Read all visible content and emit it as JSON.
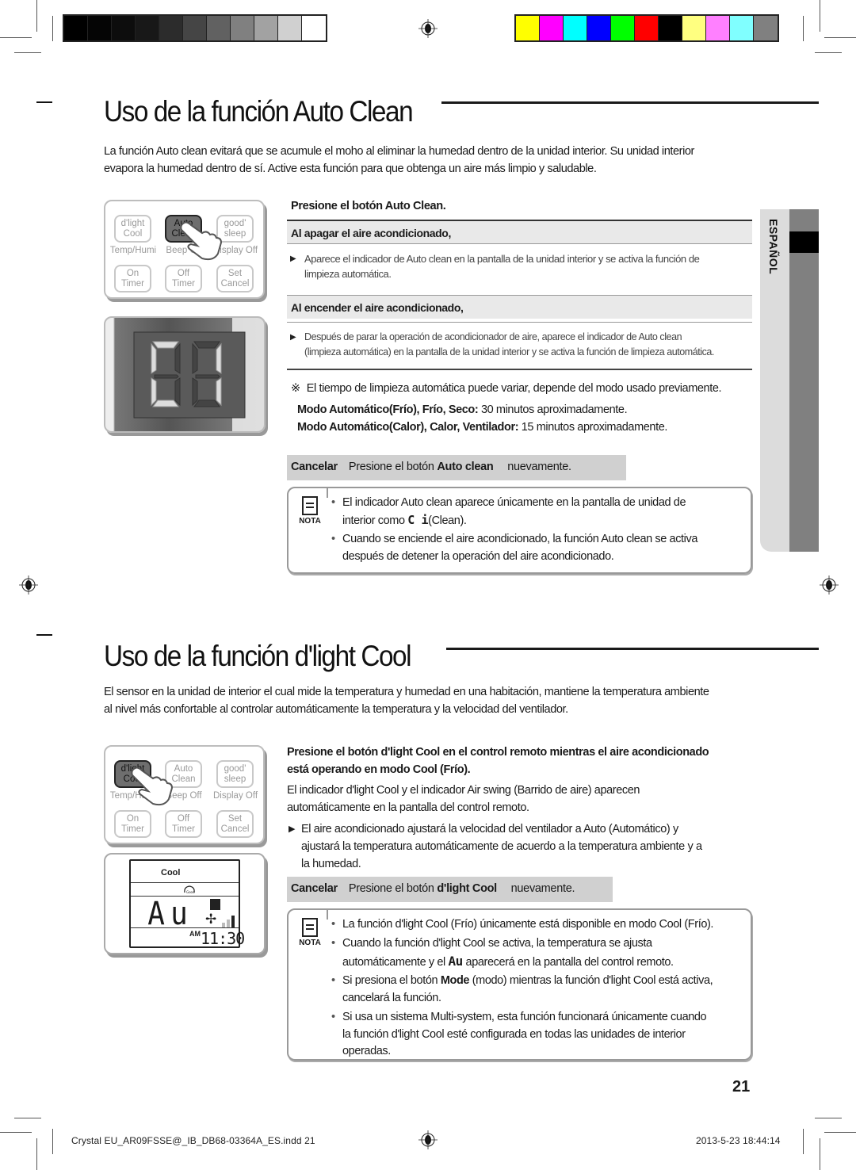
{
  "print_marks": {
    "grayscale_bar": [
      "#000000",
      "#050505",
      "#0d0d0d",
      "#181818",
      "#2c2c2c",
      "#454545",
      "#616161",
      "#808080",
      "#a2a2a2",
      "#d0d0d0",
      "#ffffff"
    ],
    "color_bar": [
      "#ffff00",
      "#ff00ff",
      "#00ffff",
      "#0000ff",
      "#00ff00",
      "#ff0000",
      "#000000",
      "#ffff80",
      "#ff80ff",
      "#80ffff",
      "#808080"
    ]
  },
  "section1": {
    "title": "Uso de la función Auto Clean",
    "intro_line1": "La función Auto clean evitará que se acumule el moho al eliminar la humedad dentro de la unidad interior. Su unidad interior",
    "intro_line2": "evapora la humedad dentro de sí. Active esta función para que obtenga un aire más limpio y saludable.",
    "remote": {
      "buttons": [
        {
          "line1": "d'light",
          "line2": "Cool",
          "sub": "Temp/Humi"
        },
        {
          "line1": "Auto",
          "line2": "Clean",
          "sub": "Beep Off"
        },
        {
          "line1": "good'",
          "line2": "sleep",
          "sub": "Display Off"
        },
        {
          "line1": "On",
          "line2": "Timer"
        },
        {
          "line1": "Off",
          "line2": "Timer"
        },
        {
          "line1": "Set",
          "line2": "Cancel"
        }
      ]
    },
    "step": {
      "prefix": "Presione el botón ",
      "button": "Auto Clean",
      "suffix": "."
    },
    "off_heading": "Al apagar el aire acondicionado,",
    "off_text_1": "Aparece el indicador de Auto clean en la pantalla de la unidad interior y se activa la función de",
    "off_text_2": "limpieza automática.",
    "on_heading": "Al encender el aire acondicionado,",
    "on_text_1": "Después de parar la operación de acondicionador de aire, aparece el indicador de Auto clean",
    "on_text_2": "(limpieza automática) en la pantalla de la unidad interior y se activa la función de limpieza automática.",
    "note_symbol": "※",
    "note": "El tiempo de limpieza automática puede variar, depende del modo usado previamente.",
    "mode1_bold": "Modo Automático(Frío), Frío, Seco:",
    "mode1_text": " 30 minutos aproximadamente.",
    "mode2_bold": "Modo Automático(Calor), Calor, Ventilador:",
    "mode2_text": " 15 minutos aproximadamente.",
    "cancel": {
      "label": "Cancelar",
      "prefix": "Presione el botón ",
      "button": "Auto clean",
      "suffix": " nuevamente."
    },
    "nota": {
      "label": "NOTA",
      "item1_line1": "El indicador Auto clean aparece únicamente en la pantalla de unidad de",
      "item1_line2_pre": "interior como ",
      "item1_glyph": "C  i",
      "item1_line2_post": "(Clean).",
      "item2_line1": "Cuando se enciende el aire acondicionado, la función Auto clean se activa",
      "item2_line2": "después de detener la operación del aire acondicionado."
    }
  },
  "side_tab": {
    "language": "ESPAÑOL"
  },
  "section2": {
    "title": "Uso de la función d'light Cool",
    "intro_line1": "El sensor en la unidad de interior el cual mide la temperatura y humedad en una habitación, mantiene la temperatura ambiente",
    "intro_line2": "al nivel más confortable al controlar automáticamente la temperatura y la velocidad del ventilador.",
    "step_line1_pre": "Presione el botón ",
    "step_line1_button": "d'light Cool",
    "step_line1_post": " en el control remoto mientras el aire acondicionado",
    "step_line2": "está operando en modo Cool (Frío).",
    "desc_line1": "El indicador d'light Cool y el indicador Air swing (Barrido de aire)  aparecen",
    "desc_line2": "automáticamente en la pantalla del control remoto.",
    "bullet_line1": "El aire acondicionado ajustará la velocidad del ventilador a Auto (Automático) y",
    "bullet_line2": "ajustará la temperatura automáticamente de acuerdo a la temperatura ambiente y a",
    "bullet_line3": "la humedad.",
    "lcd": {
      "mode": "Cool",
      "icon_label": "Good",
      "fan_display": "Au",
      "ampm": "AM",
      "time": "11:30"
    },
    "cancel": {
      "label": "Cancelar",
      "prefix": "Presione el botón ",
      "button": "d'light Cool",
      "suffix": " nuevamente."
    },
    "nota": {
      "label": "NOTA",
      "item1": "La función d'light Cool (Frío) únicamente está disponible en modo Cool (Frío).",
      "item2_line1": "Cuando la función d'light Cool se activa, la temperatura se ajusta",
      "item2_line2_pre": "automáticamente y el ",
      "item2_glyph": "Au",
      "item2_line2_post": " aparecerá en la pantalla del control remoto.",
      "item3_line1_pre": "Si presiona el botón ",
      "item3_bold": "Mode",
      "item3_line1_post": " (modo) mientras la función d'light Cool está activa,",
      "item3_line2": "cancelará la función.",
      "item4_line1": "Si usa un sistema Multi-system, esta función funcionará únicamente cuando",
      "item4_line2": "la función d'light Cool esté configurada en todas las unidades de interior",
      "item4_line3": "operadas."
    }
  },
  "page_number": "21",
  "footer": {
    "file": "Crystal  EU_AR09FSSE@_IB_DB68-03364A_ES.indd   21",
    "timestamp": "2013-5-23   18:44:14"
  }
}
